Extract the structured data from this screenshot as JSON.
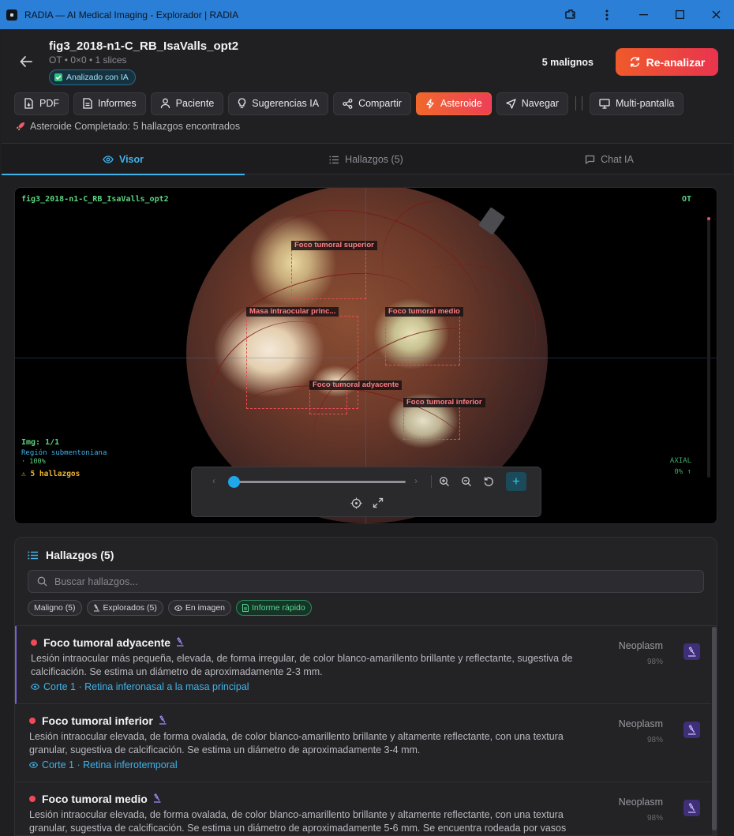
{
  "window": {
    "title": "RADIA — AI Medical Imaging - Explorador | RADIA",
    "accent": "#2b7fd6"
  },
  "header": {
    "filename": "fig3_2018-n1-C_RB_IsaValls_opt2",
    "meta": "OT • 0×0 • 1 slices",
    "ai_badge": "Analizado con IA",
    "malignos": "5 malignos",
    "reanalyze_label": "Re-analizar",
    "status": "Asteroide Completado: 5 hallazgos encontrados"
  },
  "toolbar": {
    "pdf": "PDF",
    "informes": "Informes",
    "paciente": "Paciente",
    "sugerencias": "Sugerencias IA",
    "compartir": "Compartir",
    "asteroide": "Asteroide",
    "navegar": "Navegar",
    "multipantalla": "Multi-pantalla"
  },
  "tabs": {
    "visor": "Visor",
    "hallazgos": "Hallazgos (5)",
    "chat": "Chat IA"
  },
  "viewer": {
    "top_left": "fig3_2018-n1-C_RB_IsaValls_opt2",
    "top_right": "OT",
    "img_index": "Img: 1/1",
    "region": "Región submentoniana",
    "zoom": "· 100%",
    "findings_count": "⚠ 5 hallazgos",
    "orientation": "AXIAL",
    "position": "0% ↑",
    "slider_value": 0,
    "boxes": {
      "b1": "Foco tumoral superior",
      "b2": "Masa intraocular princ...",
      "b3": "Foco tumoral medio",
      "b4": "Foco tumoral adyacente",
      "b5": "Foco tumoral inferior"
    }
  },
  "findings": {
    "title": "Hallazgos (5)",
    "search_placeholder": "Buscar hallazgos...",
    "chips": {
      "maligno": "Maligno (5)",
      "explorados": "Explorados (5)",
      "en_imagen": "En imagen",
      "informe": "Informe rápido"
    },
    "items": [
      {
        "name": "Foco tumoral adyacente",
        "desc": "Lesión intraocular más pequeña, elevada, de forma irregular, de color blanco-amarillento brillante y reflectante, sugestiva de calcificación. Se estima un diámetro de aproximadamente 2-3 mm.",
        "loc": "Corte 1 · Retina inferonasal a la masa principal",
        "type": "Neoplasm",
        "conf": "98%"
      },
      {
        "name": "Foco tumoral inferior",
        "desc": "Lesión intraocular elevada, de forma ovalada, de color blanco-amarillento brillante y altamente reflectante, con una textura granular, sugestiva de calcificación. Se estima un diámetro de aproximadamente 3-4 mm.",
        "loc": "Corte 1 · Retina inferotemporal",
        "type": "Neoplasm",
        "conf": "98%"
      },
      {
        "name": "Foco tumoral medio",
        "desc": "Lesión intraocular elevada, de forma ovalada, de color blanco-amarillento brillante y altamente reflectante, con una textura granular, sugestiva de calcificación. Se estima un diámetro de aproximadamente 5-6 mm. Se encuentra rodeada por vasos",
        "loc": "",
        "type": "Neoplasm",
        "conf": "98%"
      }
    ]
  }
}
